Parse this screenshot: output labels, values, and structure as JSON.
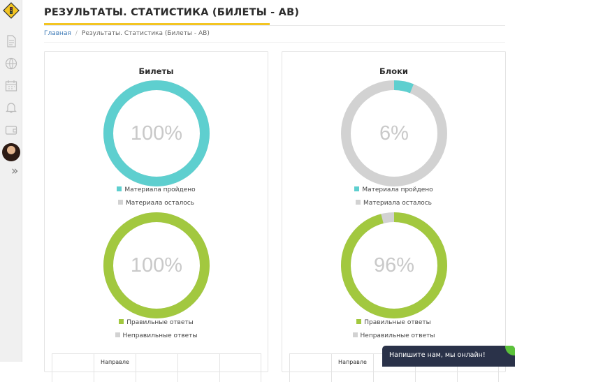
{
  "page": {
    "title": "РЕЗУЛЬТАТЫ. СТАТИСТИКА (БИЛЕТЫ - АВ)"
  },
  "breadcrumb": {
    "home": "Главная",
    "separator": "/",
    "current": "Результаты. Статистика (Билеты - АВ)"
  },
  "sidebar": {
    "icons": [
      "road-sign-logo-icon",
      "document-icon",
      "globe-icon",
      "calendar-icon",
      "bell-icon",
      "wallet-icon",
      "avatar",
      "double-chevron-right-icon"
    ],
    "expand_glyph": "»"
  },
  "colors": {
    "accent": "#f3c522",
    "teal": "#5ecfcf",
    "gray": "#d2d2d2",
    "green": "#a2c83f",
    "chat_bg": "#2a3249",
    "online": "#5cc23a",
    "link": "#3a78b5"
  },
  "panels": [
    {
      "title": "Билеты",
      "progress": {
        "percent_label": "100%",
        "done_fraction": 1.0
      },
      "progress_legend": {
        "done": "Материала пройдено",
        "remaining": "Материала осталось"
      },
      "correctness": {
        "percent_label": "100%",
        "correct_fraction": 1.0
      },
      "correctness_legend": {
        "correct": "Правильные ответы",
        "wrong": "Неправильные ответы"
      },
      "table_header_partial": "Направле"
    },
    {
      "title": "Блоки",
      "progress": {
        "percent_label": "6%",
        "done_fraction": 0.06
      },
      "progress_legend": {
        "done": "Материала пройдено",
        "remaining": "Материала осталось"
      },
      "correctness": {
        "percent_label": "96%",
        "correct_fraction": 0.96
      },
      "correctness_legend": {
        "correct": "Правильные ответы",
        "wrong": "Неправильные ответы"
      },
      "table_header_partial": "Направле"
    }
  ],
  "chat": {
    "label": "Напишите нам, мы онлайн!"
  }
}
